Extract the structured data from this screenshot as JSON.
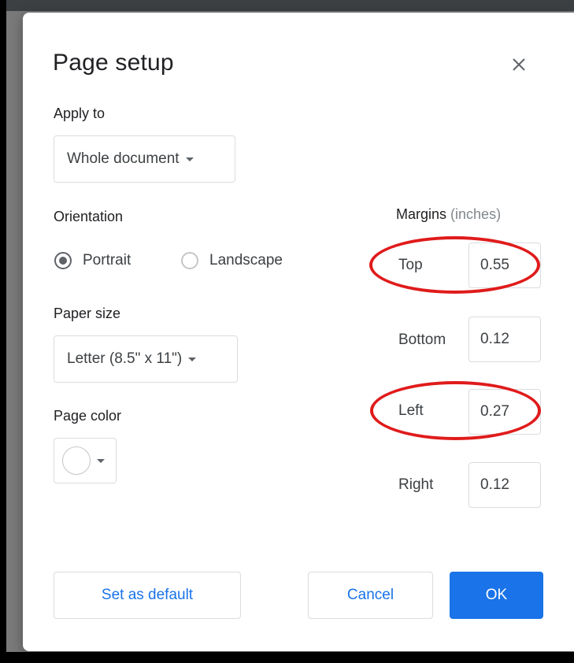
{
  "dialog": {
    "title": "Page setup",
    "close_icon": "close-icon"
  },
  "apply_to": {
    "label": "Apply to",
    "selected": "Whole document"
  },
  "orientation": {
    "label": "Orientation",
    "options": [
      {
        "label": "Portrait",
        "selected": true
      },
      {
        "label": "Landscape",
        "selected": false
      }
    ]
  },
  "paper_size": {
    "label": "Paper size",
    "selected": "Letter (8.5\" x 11\")"
  },
  "page_color": {
    "label": "Page color",
    "value": "#ffffff"
  },
  "margins": {
    "label": "Margins",
    "unit": "(inches)",
    "top": {
      "label": "Top",
      "value": "0.55"
    },
    "bottom": {
      "label": "Bottom",
      "value": "0.12"
    },
    "left": {
      "label": "Left",
      "value": "0.27"
    },
    "right": {
      "label": "Right",
      "value": "0.12"
    }
  },
  "buttons": {
    "set_default": "Set as default",
    "cancel": "Cancel",
    "ok": "OK"
  },
  "colors": {
    "accent": "#1a73e8",
    "annotation": "#e01b1b"
  }
}
